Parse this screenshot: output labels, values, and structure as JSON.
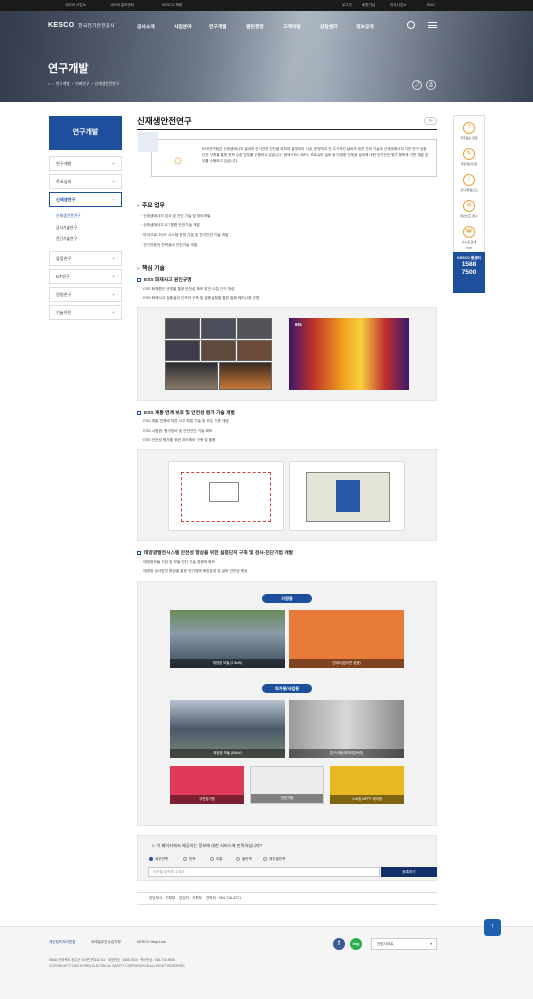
{
  "topbar": {
    "links": [
      "사이버 사업소",
      "사이버 홍보센터",
      "KESCO 채용"
    ],
    "login": "로그인",
    "signup": "회원가입",
    "sitemap": "전국사업소",
    "lang": "ENG"
  },
  "header": {
    "logo": "KESCO",
    "org_name": "한국전기안전공사",
    "nav": [
      "공사소개",
      "사업분야",
      "연구개발",
      "열린경영",
      "고객마당",
      "상담센터",
      "정보공개"
    ]
  },
  "hero": {
    "title": "연구개발",
    "breadcrumb": [
      "연구개발",
      "미래연구",
      "신재생안전연구"
    ]
  },
  "sidebar": {
    "title": "연구개발",
    "items": [
      "연구개발",
      "주요성과",
      "신재생연구",
      "융합연구",
      "IoT연구",
      "정밀연구",
      "기술이전"
    ],
    "sub_items": [
      "신재생안전연구",
      "검사기술연구",
      "진단기술연구"
    ]
  },
  "main": {
    "title": "신재생안전연구",
    "intro": "ESS연구팀은 신재생에너지 설비의 전기안전 진단을 위하여 설계부터 시공, 운영까지 전 주기적인 설비의 위치 관리 기술과 신재생에너지 기반 연구 검증 단지 구축을 통한 전력 수집 업무를 수행하고 있습니다. 현재 ESS, BIPV, 프로슈머 설비 등 다양한 신재생 설비에 대한 전기안전 평가 항목과 기반 개발 업무를 수행하고 있습니다.",
    "s1": {
      "title": "주요 업무",
      "items": [
        "신재생에너지 검사 및 진단 기술 및 장비개발",
        "신재생에너지 ICT융합 안전기술 개발",
        "마이크로그리드 시스템 운영 기술 및 전기안전 기술 개발",
        "전기자동차 전력설비 안전기술 개발"
      ]
    },
    "s2": {
      "title": "핵심 기술",
      "t1": {
        "title": "ESS 화재사고 원인규명",
        "items": [
          "ESS 화재원인 규명을 통한 안전성 확보 방안 수립 근거 마련",
          "ESS 화재사고 검증설비 인프라 구축 및 검증실험을 통한 발화 메커니즘 규명"
        ],
        "thermal": "691"
      },
      "t2": {
        "title": "ESS 계통 연계 보호 및 안전성 평가 기술 개발",
        "items": [
          "ESS 계통 연계에 따른 사고 해법 기술 및 보호 기준 개발",
          "ESS 시험편· 평가장비 및 안전진단 기술 확보",
          "ESS 안전성 평가를 위한 하드웨어 구축 및 활용"
        ]
      },
      "t3": {
        "title": "태양광발전시스템 안전성 향상을 위한 실증단지 구축 및 검사·진단기법 개발",
        "items": [
          "태양광모듈 고장 및 모듈 진단 기술 경쟁력 확보",
          "태양광 검사방안 향상을 통한 전기재해 예방효과 및 설비 안전성 향상"
        ],
        "group1": "가정용",
        "g1": [
          "태양광 모듈 (2.5kW)",
          "인버터(접속반 겸용)"
        ],
        "group2": "자가용/사업용",
        "g2": [
          "태양광 모듈 (50kW)",
          "접구사용(에어터접속반)",
          "무변압기형",
          "변압기형",
          "스트링 MPPT 제어형"
        ]
      }
    }
  },
  "quick": {
    "items": [
      "자주묻는 질문",
      "국민제안신청",
      "감사/청렴신고",
      "위반신고 접수",
      "수수료 안내"
    ],
    "top": "TOP",
    "call_label": "KESCO 콜센터",
    "call_num1": "1588",
    "call_num2": "7500"
  },
  "survey": {
    "question": "이 페이지에서 제공하는 정보에 대한 서비스에 만족하십니까?",
    "options": [
      "매우만족",
      "만족",
      "보통",
      "불만족",
      "매우불만족"
    ],
    "placeholder": "의견을 입력해 주세요.",
    "submit": "등록하기"
  },
  "manager": {
    "dept": "담당부서 : 기획부",
    "person": "담당자 : 기획부",
    "phone": "연락처 : 063-716-2071"
  },
  "footer": {
    "links": [
      "개인정보처리방침",
      "이메일무단수집거부",
      "KESCO Help-Line"
    ],
    "addr": "55365 전라북도 완주군 이서면 반교로 111 · 대표번호 : 1588-7500 · 팩스번호 : 063-716-9838",
    "copy": "COPYRIGHT © 2020 KOREA ELECTRICAL SAFETY CORPORATION ALL RIGHT RESERVED.",
    "select": "관련사이트",
    "blog": "blog",
    "fb": "f"
  }
}
